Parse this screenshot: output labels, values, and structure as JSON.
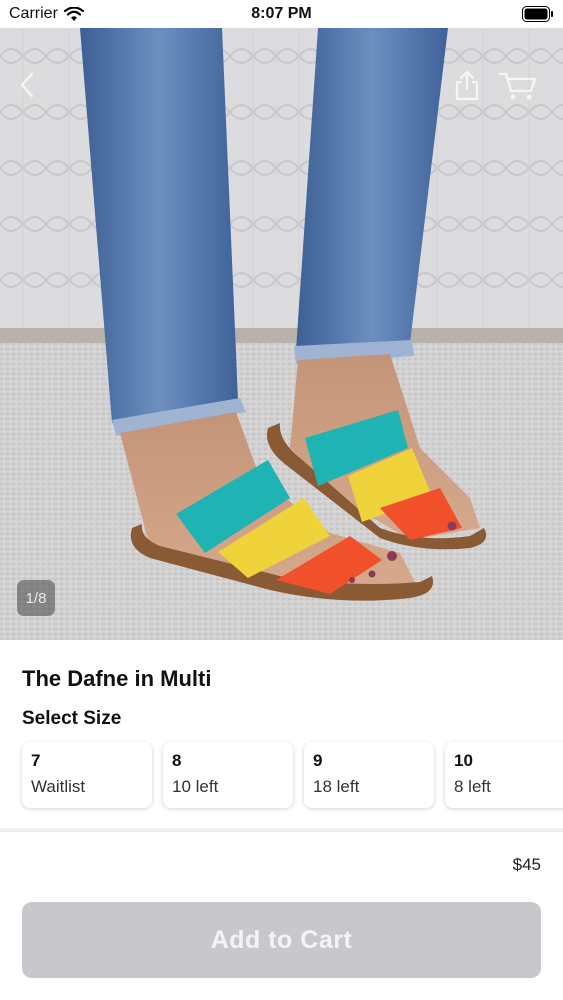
{
  "status_bar": {
    "carrier": "Carrier",
    "time": "8:07 PM"
  },
  "nav": {
    "back_icon": "chevron-left-icon",
    "share_icon": "share-icon",
    "cart_icon": "cart-icon"
  },
  "gallery": {
    "counter": "1/8"
  },
  "product": {
    "title": "The Dafne in Multi",
    "price": "$45"
  },
  "size_section": {
    "heading": "Select Size",
    "sizes": [
      {
        "size": "7",
        "stock": "Waitlist"
      },
      {
        "size": "8",
        "stock": "10 left"
      },
      {
        "size": "9",
        "stock": "18 left"
      },
      {
        "size": "10",
        "stock": "8 left"
      }
    ]
  },
  "cart_button": {
    "label": "Add to Cart",
    "state": "disabled"
  },
  "colors": {
    "button_disabled": "#c7c7cc",
    "strap_teal": "#1fb3b3",
    "strap_yellow": "#f0d23a",
    "strap_orange": "#f0502a"
  }
}
